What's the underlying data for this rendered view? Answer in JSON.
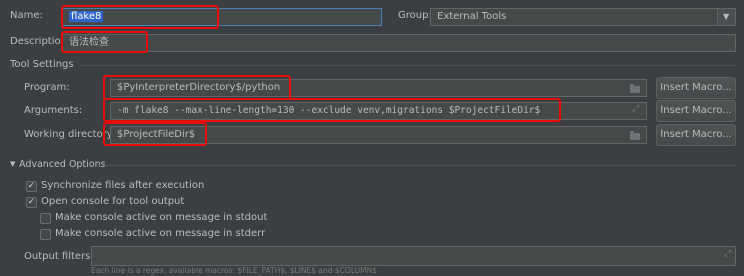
{
  "name_label": "Name:",
  "name_value": "flake8",
  "group_label": "Group:",
  "group_value": "External Tools",
  "description_label": "Description:",
  "description_value": "语法检查",
  "tool_settings_label": "Tool Settings",
  "program": {
    "label": "Program:",
    "value": "$PyInterpreterDirectory$/python",
    "button": "Insert Macro..."
  },
  "arguments": {
    "label": "Arguments:",
    "value": "-m flake8 --max-line-length=130 --exclude venv,migrations $ProjectFileDir$",
    "button": "Insert Macro..."
  },
  "working_directory": {
    "label": "Working directory:",
    "value": "$ProjectFileDir$",
    "button": "Insert Macro..."
  },
  "advanced_options_label": "Advanced Options",
  "options": [
    {
      "label": "Synchronize files after execution",
      "checked": true
    },
    {
      "label": "Open console for tool output",
      "checked": true
    },
    {
      "label": "Make console active on message in stdout",
      "checked": false
    },
    {
      "label": "Make console active on message in stderr",
      "checked": false
    }
  ],
  "output_filters_label": "Output filters:",
  "output_filters_value": "",
  "hint": "Each line is a regex, available macros: $FILE_PATH$, $LINE$ and $COLUMN$",
  "colors": {
    "background": "#3c3f41",
    "field": "#45494a",
    "highlight_border": "#e60d0d",
    "selection": "#2f65ca"
  }
}
